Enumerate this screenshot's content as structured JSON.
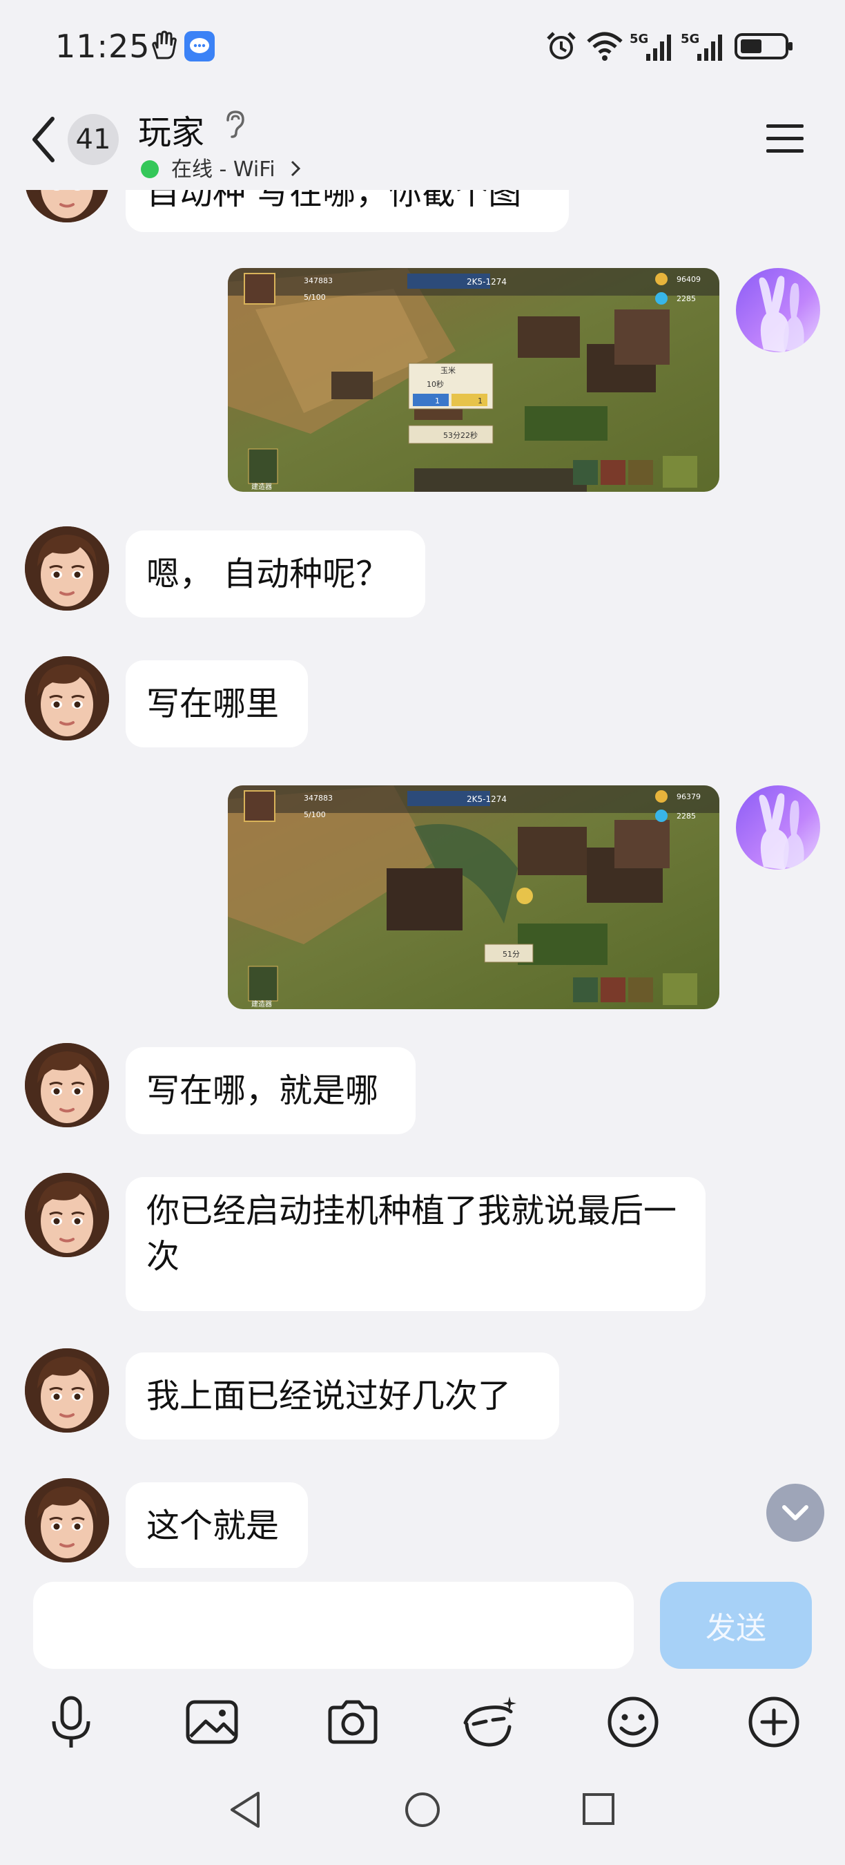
{
  "status_bar": {
    "time": "11:25"
  },
  "header": {
    "unread_count": "41",
    "chat_name": "玩家",
    "status": "在线 - WiFi"
  },
  "messages": {
    "partial_text": "自动种 写在哪，你截个图",
    "m1": "嗯， 自动种呢？",
    "m2": "写在哪里",
    "m3": "写在哪，就是哪",
    "m4": "你已经启动挂机种植了我就说最后一次",
    "m5": "我上面已经说过好几次了",
    "m6": "这个就是"
  },
  "screenshot1": {
    "resource_1": "347883",
    "resource_2": "5/100",
    "level_tag": "2K5-1274",
    "gold": "96409",
    "gems": "2285",
    "tooltip_title": "玉米",
    "tooltip_time": "10秒",
    "tooltip_cost_a": "1",
    "tooltip_cost_b": "1",
    "timer": "53分22秒",
    "bottom_left_label": "建造器"
  },
  "screenshot2": {
    "resource_1": "347883",
    "resource_2": "5/100",
    "level_tag": "2K5-1274",
    "gold": "96379",
    "gems": "2285",
    "timer": "51分",
    "bottom_left_label": "建造器"
  },
  "input": {
    "placeholder": "",
    "send_label": "发送"
  },
  "icons": {
    "toolbar": [
      "microphone-icon",
      "image-icon",
      "camera-icon",
      "hongbao-mask-icon",
      "emoji-icon",
      "plus-icon"
    ],
    "nav": [
      "back-triangle-icon",
      "home-circle-icon",
      "recents-square-icon"
    ]
  },
  "colors": {
    "send_disabled": "#a7d1f7",
    "online": "#34c759",
    "background": "#f2f2f5"
  }
}
